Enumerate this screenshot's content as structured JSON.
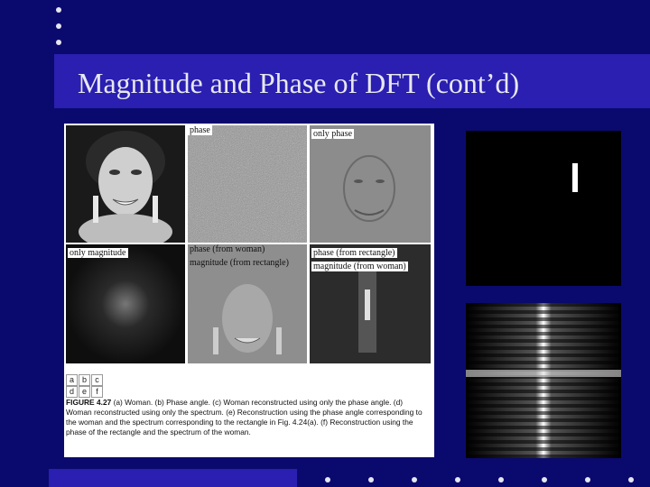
{
  "slide": {
    "title": "Magnitude and Phase of DFT (cont’d)"
  },
  "figure": {
    "labels": {
      "phase": "phase",
      "only_phase": "only phase",
      "only_magnitude": "only magnitude",
      "phase_woman": "phase (from woman)",
      "magnitude_rectangle": "magnitude (from rectangle)",
      "phase_rectangle": "phase (from rectangle)",
      "magnitude_woman": "magnitude (from woman)"
    },
    "panel_letters": [
      "a",
      "b",
      "c",
      "d",
      "e",
      "f"
    ],
    "caption_heading": "FIGURE 4.27",
    "caption_text": "(a) Woman. (b) Phase angle. (c) Woman reconstructed using only the phase angle. (d) Woman reconstructed using only the spectrum. (e) Reconstruction using the phase angle corresponding to the woman and the spectrum corresponding to the rectangle in Fig. 4.24(a). (f) Reconstruction using the phase of the rectangle and the spectrum of the woman."
  },
  "colors": {
    "background": "#0a0a6e",
    "title_band": "#2a1fb0",
    "title_text": "#e8e8f0"
  }
}
